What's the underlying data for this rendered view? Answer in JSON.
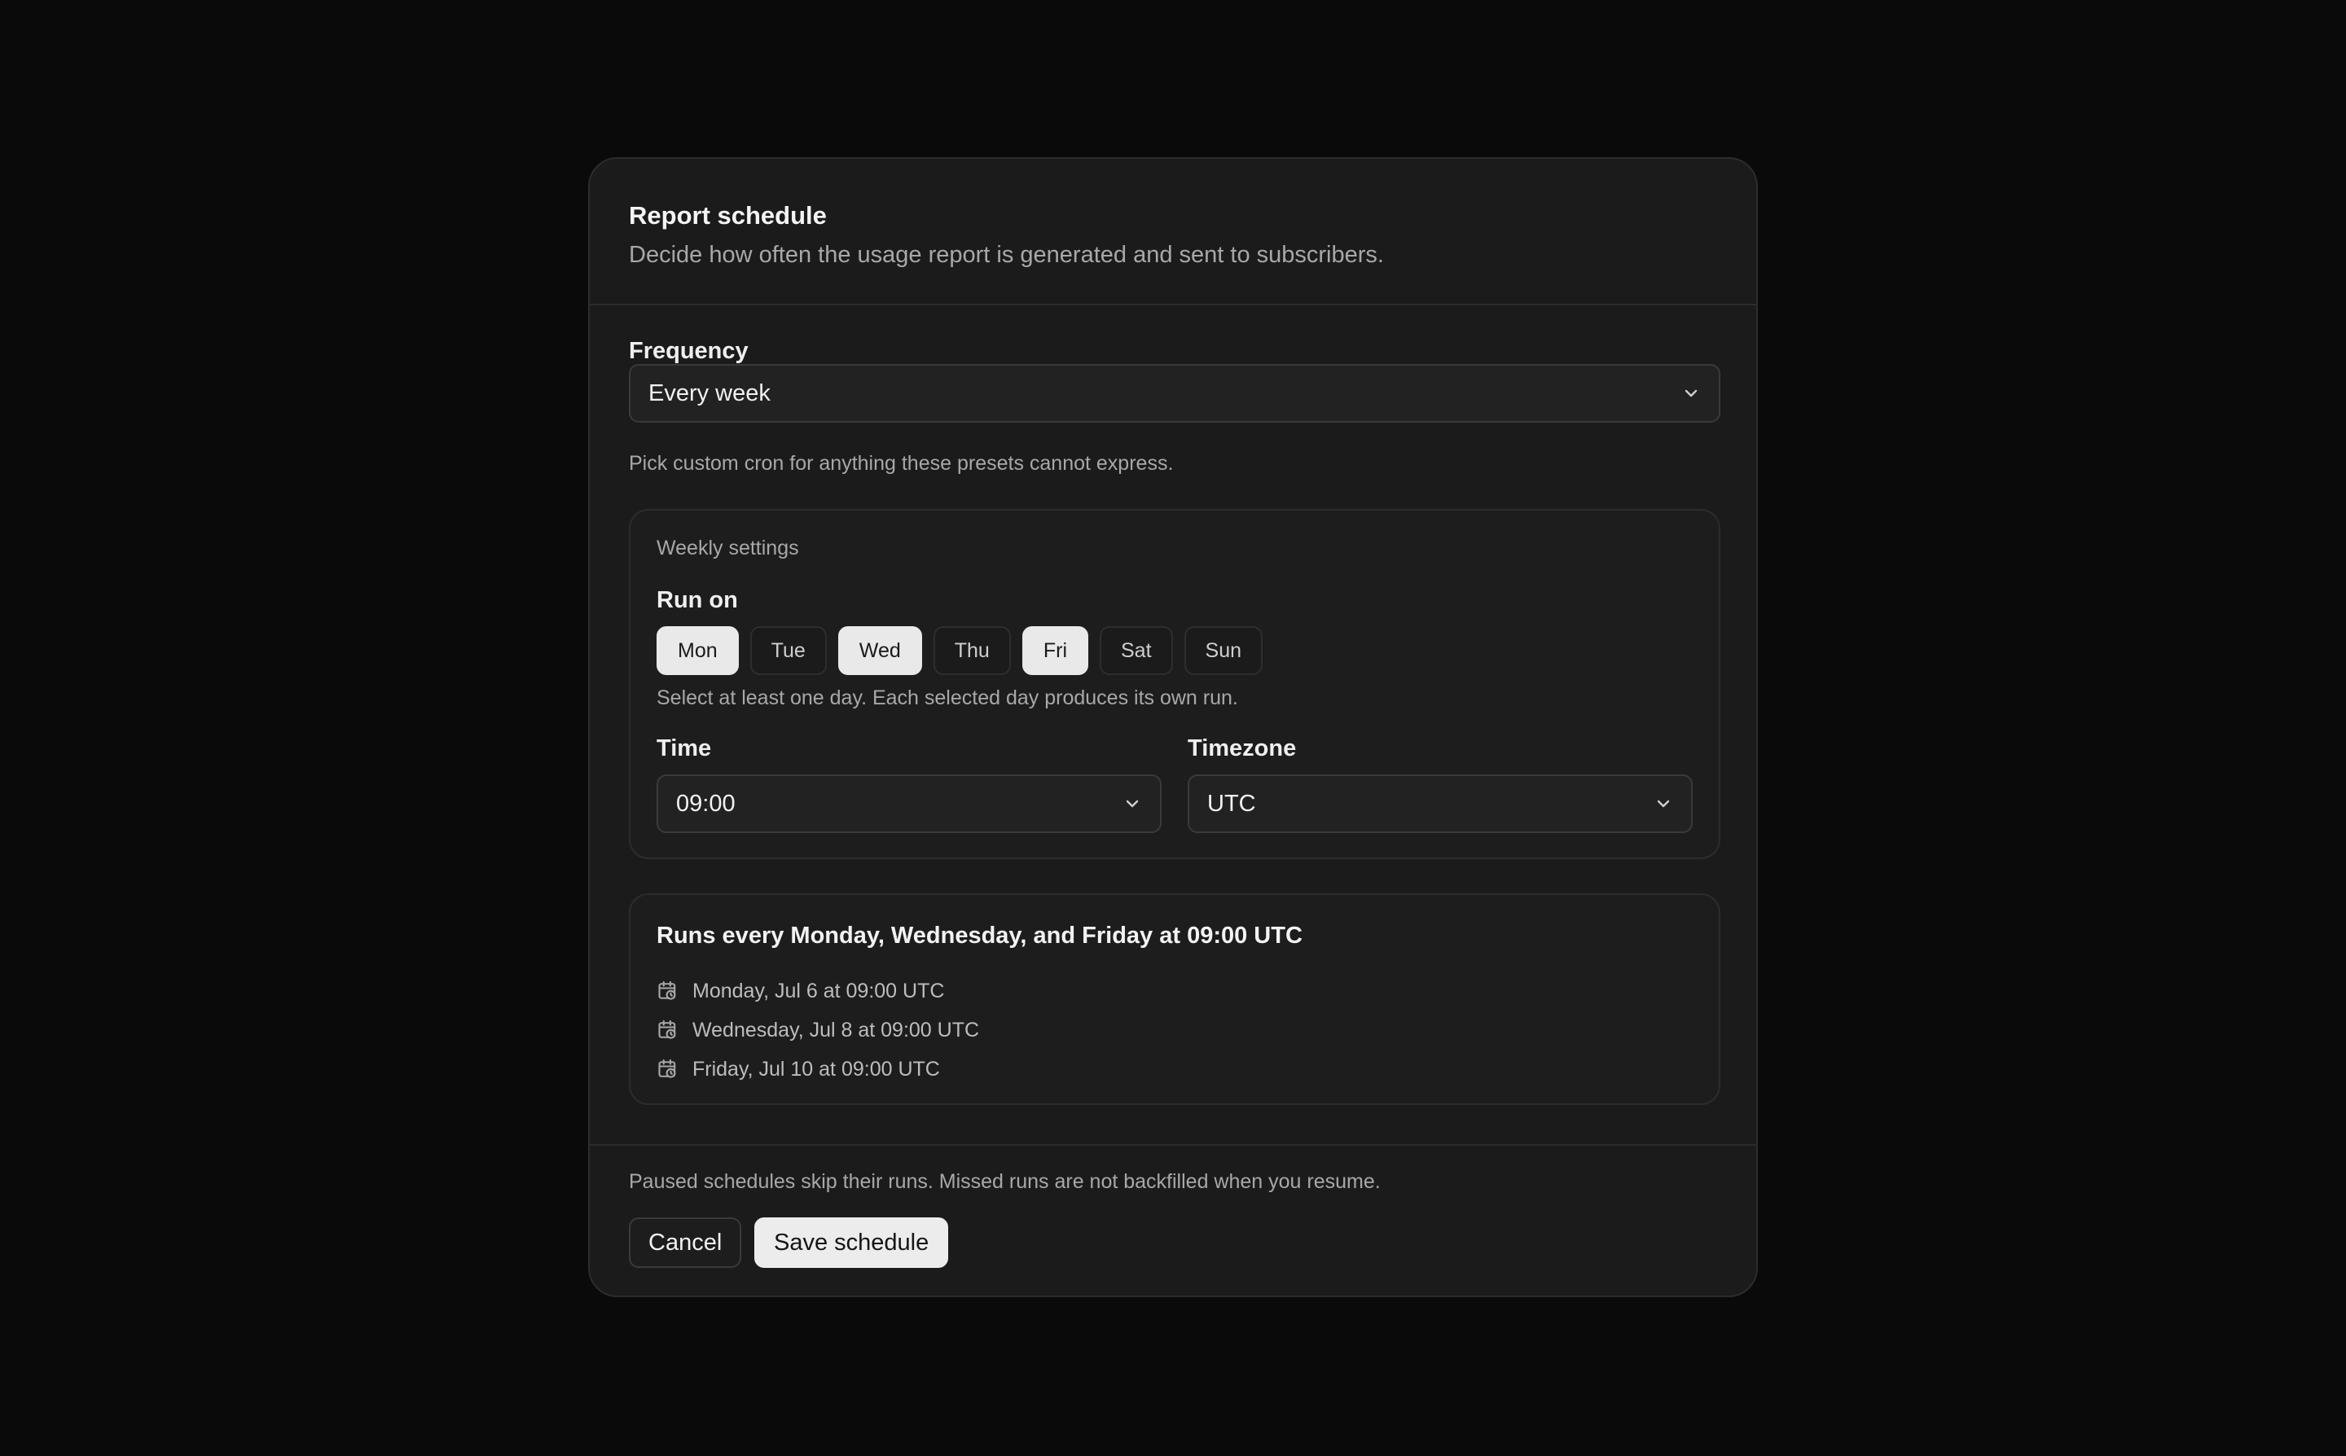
{
  "header": {
    "title": "Report schedule",
    "subtitle": "Decide how often the usage report is generated and sent to subscribers."
  },
  "frequency": {
    "label": "Frequency",
    "value": "Every week",
    "hint": "Pick custom cron for anything these presets cannot express."
  },
  "weekly": {
    "title": "Weekly settings",
    "run_on_label": "Run on",
    "days": [
      {
        "label": "Mon",
        "selected": true
      },
      {
        "label": "Tue",
        "selected": false
      },
      {
        "label": "Wed",
        "selected": true
      },
      {
        "label": "Thu",
        "selected": false
      },
      {
        "label": "Fri",
        "selected": true
      },
      {
        "label": "Sat",
        "selected": false
      },
      {
        "label": "Sun",
        "selected": false
      }
    ],
    "days_hint": "Select at least one day. Each selected day produces its own run.",
    "time_label": "Time",
    "time_value": "09:00",
    "timezone_label": "Timezone",
    "timezone_value": "UTC"
  },
  "preview": {
    "title": "Runs every Monday, Wednesday, and Friday at 09:00 UTC",
    "runs": [
      "Monday, Jul 6 at 09:00 UTC",
      "Wednesday, Jul 8 at 09:00 UTC",
      "Friday, Jul 10 at 09:00 UTC"
    ]
  },
  "footer": {
    "note": "Paused schedules skip their runs. Missed runs are not backfilled when you resume.",
    "cancel_label": "Cancel",
    "save_label": "Save schedule"
  },
  "icons": {
    "chevron": "chevron-down-icon",
    "calendar": "calendar-clock-icon"
  }
}
